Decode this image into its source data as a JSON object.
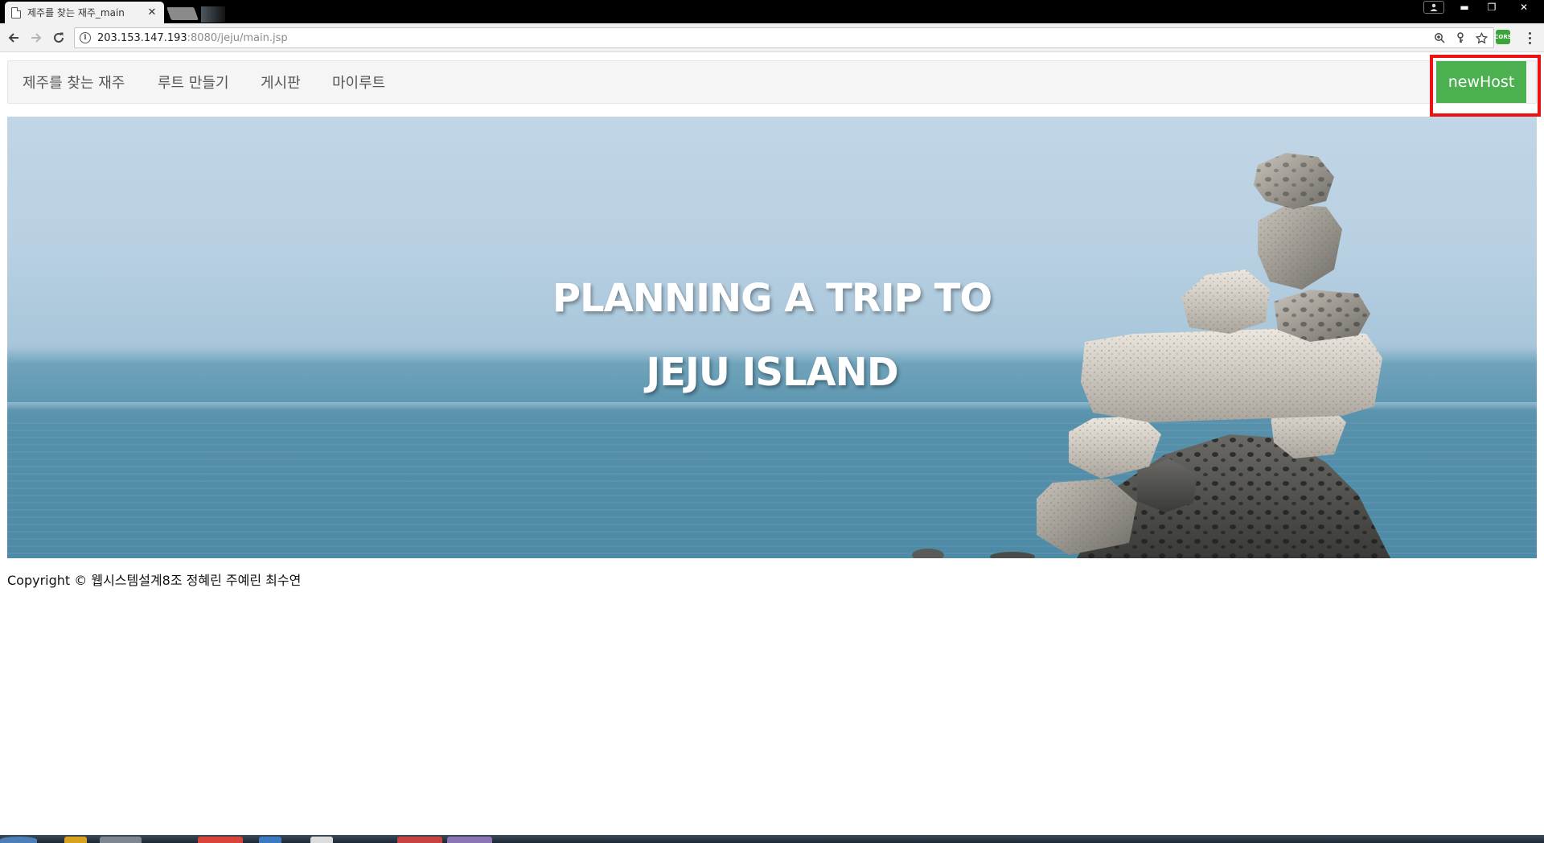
{
  "browser": {
    "tab_title": "제주를 찾는 재주_main",
    "tab_close": "✕",
    "window_controls": {
      "minimize": "▬",
      "restore": "❐",
      "close": "✕"
    },
    "url_host": "203.153.147.193",
    "url_rest": ":8080/jeju/main.jsp",
    "extension_label": "CORS",
    "icons": [
      "back-icon",
      "forward-icon",
      "reload-icon",
      "info-icon",
      "zoom-icon",
      "key-icon",
      "star-icon",
      "menu-icon"
    ]
  },
  "navbar": {
    "items": [
      {
        "label": "제주를 찾는 재주"
      },
      {
        "label": "루트 만들기"
      },
      {
        "label": "게시판"
      },
      {
        "label": "마이루트"
      }
    ],
    "user_button": "newHost"
  },
  "hero": {
    "line1": "PLANNING A TRIP TO",
    "line2": "JEJU ISLAND"
  },
  "footer": {
    "text": "Copyright © 웹시스템설계8조 정혜린 주예린 최수연"
  },
  "colors": {
    "accent_green": "#4caf50",
    "highlight_red": "#ee1111",
    "navbar_bg": "#f5f5f5"
  }
}
